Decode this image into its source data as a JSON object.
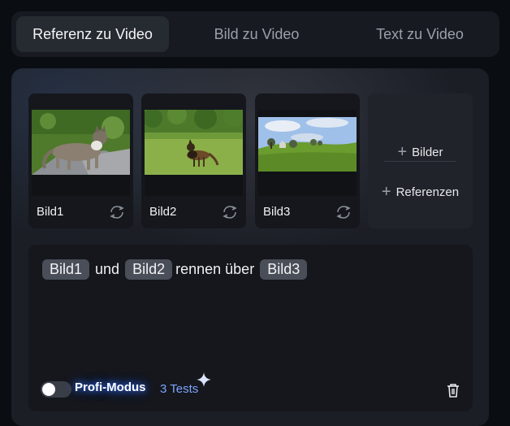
{
  "tabs": [
    {
      "label": "Referenz zu Video",
      "active": true
    },
    {
      "label": "Bild zu Video",
      "active": false
    },
    {
      "label": "Text zu Video",
      "active": false
    }
  ],
  "references": [
    {
      "label": "Bild1",
      "subject": "cat-on-rock"
    },
    {
      "label": "Bild2",
      "subject": "dog-on-meadow"
    },
    {
      "label": "Bild3",
      "subject": "green-hill-landscape"
    }
  ],
  "add_actions": {
    "images_label": "Bilder",
    "references_label": "Referenzen"
  },
  "prompt": {
    "chip1": "Bild1",
    "word1": "und",
    "chip2": "Bild2",
    "word2": "rennen über",
    "chip3": "Bild3"
  },
  "footer": {
    "pro_mode_label": "Profi-Modus",
    "pro_mode_enabled": false,
    "tests_label": "3 Tests"
  },
  "icons": {
    "swap": "swap-icon",
    "plus": "plus-icon",
    "sparkle": "sparkle-icon",
    "trash": "trash-icon"
  },
  "colors": {
    "accent_glow": "#2f6cff",
    "tests_text": "#7ea4ff",
    "chip_bg": "#4a4e58"
  }
}
